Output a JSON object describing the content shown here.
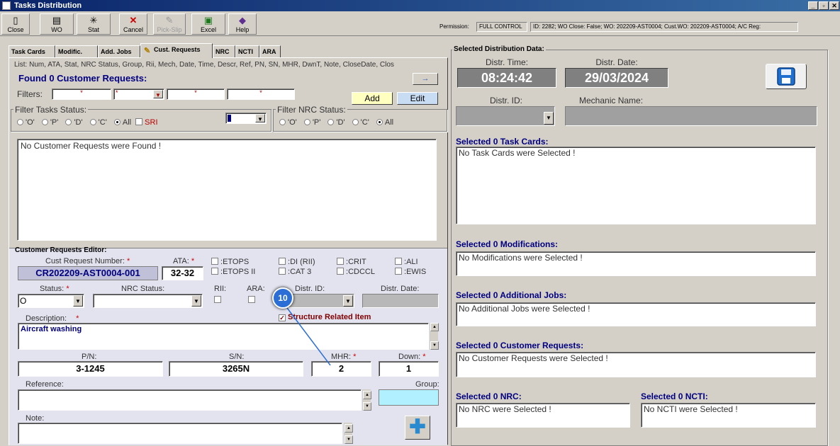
{
  "window": {
    "title": "Tasks Distribution",
    "controls": [
      "_",
      "▫",
      "✕"
    ]
  },
  "toolbar": {
    "buttons": [
      {
        "label": "Close",
        "icon": "door-icon"
      },
      {
        "label": "WO",
        "icon": "printer-icon"
      },
      {
        "label": "Stat",
        "icon": "asterisk-icon"
      },
      {
        "label": "Cancel",
        "icon": "cancel-x-icon"
      },
      {
        "label": "Pick-Slip",
        "icon": "pick-slip-icon"
      },
      {
        "label": "Excel",
        "icon": "excel-icon"
      },
      {
        "label": "Help",
        "icon": "help-icon"
      }
    ],
    "permission_label": "Permission:",
    "permission_value": "FULL CONTROL",
    "info": "ID: 2282; WO Close: False; WO: 202209-AST0004; Cust.WO: 202209-AST0004; A/C Reg:"
  },
  "tabs": [
    "Task Cards",
    "Modific.",
    "Add. Jobs",
    "Cust. Requests",
    "NRC",
    "NCTI",
    "ARA"
  ],
  "left": {
    "list_header": "List: Num, ATA, Stat, NRC Status, Group, Rii, Mech, Date, Time, Descr, Ref, PN, SN, MHR, DwnT, Note, CloseDate, Clos",
    "found_label": "Found 0 Customer Requests:",
    "arrow_button": "→",
    "filters_label": "Filters:",
    "filter_values": [
      "*",
      "*",
      "*",
      "*"
    ],
    "add_button": "Add",
    "edit_button": "Edit",
    "filter_tasks_title": "Filter Tasks Status:",
    "task_radios": [
      "'O'",
      "'P'",
      "'D'",
      "'C'",
      "All"
    ],
    "sri_label": "SRI",
    "filter_nrc_title": "Filter NRC Status:",
    "nrc_radios": [
      "'O'",
      "'P'",
      "'D'",
      "'C'",
      "All"
    ],
    "list_empty": "No Customer Requests were Found !"
  },
  "editor": {
    "title": "Customer Requests Editor:",
    "cust_req_label": "Cust Request Number:",
    "cust_req_value": "CR202209-AST0004-001",
    "ata_label": "ATA:",
    "ata_value": "32-32",
    "checks": [
      "ETOPS",
      "ETOPS II",
      "DI (RII)",
      "CAT 3",
      "CRIT",
      "CDCCL",
      "ALI",
      "EWIS"
    ],
    "status_label": "Status:",
    "status_value": "O",
    "nrc_status_label": "NRC Status:",
    "rii_label": "RII:",
    "ara_label": "ARA:",
    "distr_id_label": "Distr. ID:",
    "distr_date_label": "Distr. Date:",
    "structure_label": "Structure Related Item",
    "description_label": "Description:",
    "description_value": "Aircraft washing",
    "pn_label": "P/N:",
    "pn_value": "3-1245",
    "sn_label": "S/N:",
    "sn_value": "3265N",
    "mhr_label": "MHR:",
    "mhr_value": "2",
    "down_label": "Down:",
    "down_value": "1",
    "reference_label": "Reference:",
    "group_label": "Group:",
    "note_label": "Note:"
  },
  "right": {
    "title": "Selected Distribution Data:",
    "distr_time_label": "Distr. Time:",
    "distr_time_value": "08:24:42",
    "distr_date_label": "Distr. Date:",
    "distr_date_value": "29/03/2024",
    "distr_id_label": "Distr. ID:",
    "mechanic_label": "Mechanic Name:",
    "sections": [
      {
        "title": "Selected 0 Task Cards:",
        "text": "No Task Cards were Selected !"
      },
      {
        "title": "Selected 0 Modifications:",
        "text": "No Modifications were Selected !"
      },
      {
        "title": "Selected 0 Additional Jobs:",
        "text": "No Additional Jobs were Selected !"
      },
      {
        "title": "Selected 0 Customer Requests:",
        "text": "No Customer Requests were Selected !"
      },
      {
        "title": "Selected 0 NRC:",
        "text": "No NRC were Selected !"
      },
      {
        "title": "Selected 0 NCTI:",
        "text": "No NCTI were Selected !"
      }
    ]
  },
  "callout": "10"
}
